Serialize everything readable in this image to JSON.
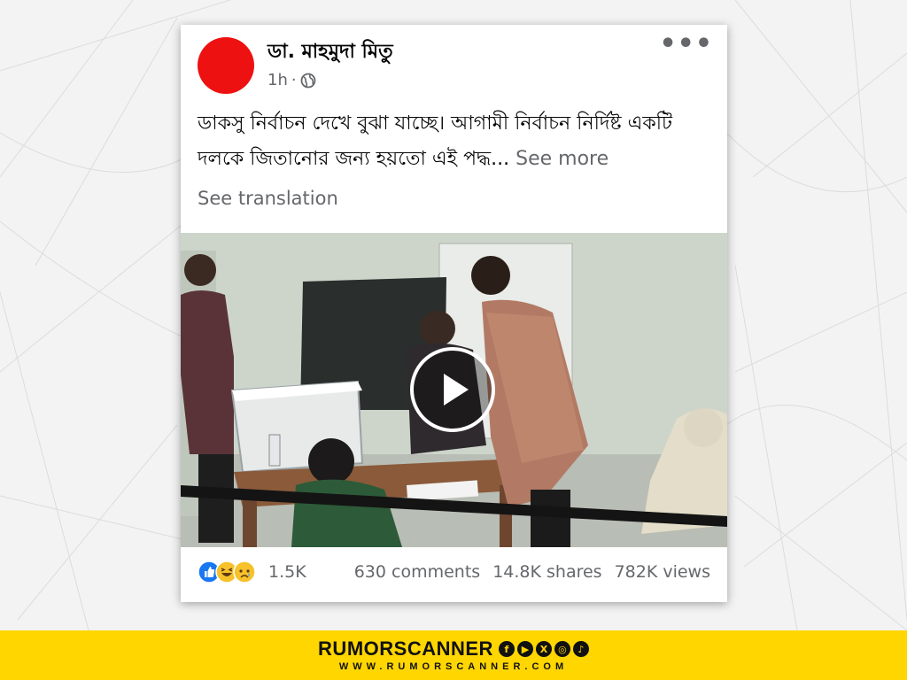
{
  "post": {
    "author": "ডা. মাহমুদা মিতু",
    "time": "1h",
    "separator": "·",
    "text": "ডাকসু নির্বাচন দেখে বুঝা যাচ্ছে।  আগামী নির্বাচন নির্দিষ্ট একটি দলকে জিতানোর জন্য হয়তো এই পদ্ধ...",
    "see_more": "See more",
    "see_translation": "See translation"
  },
  "stats": {
    "reactions": "1.5K",
    "comments": "630 comments",
    "shares": "14.8K shares",
    "views": "782K views"
  },
  "footer": {
    "brand": "RUMORSCANNER",
    "website": "WWW.RUMORSCANNER.COM",
    "social_icons": [
      "facebook-icon",
      "youtube-icon",
      "x-icon",
      "instagram-icon",
      "tiktok-icon"
    ]
  },
  "colors": {
    "avatar": "#ee1111",
    "footer_bg": "#ffd600",
    "meta_text": "#65676b"
  }
}
